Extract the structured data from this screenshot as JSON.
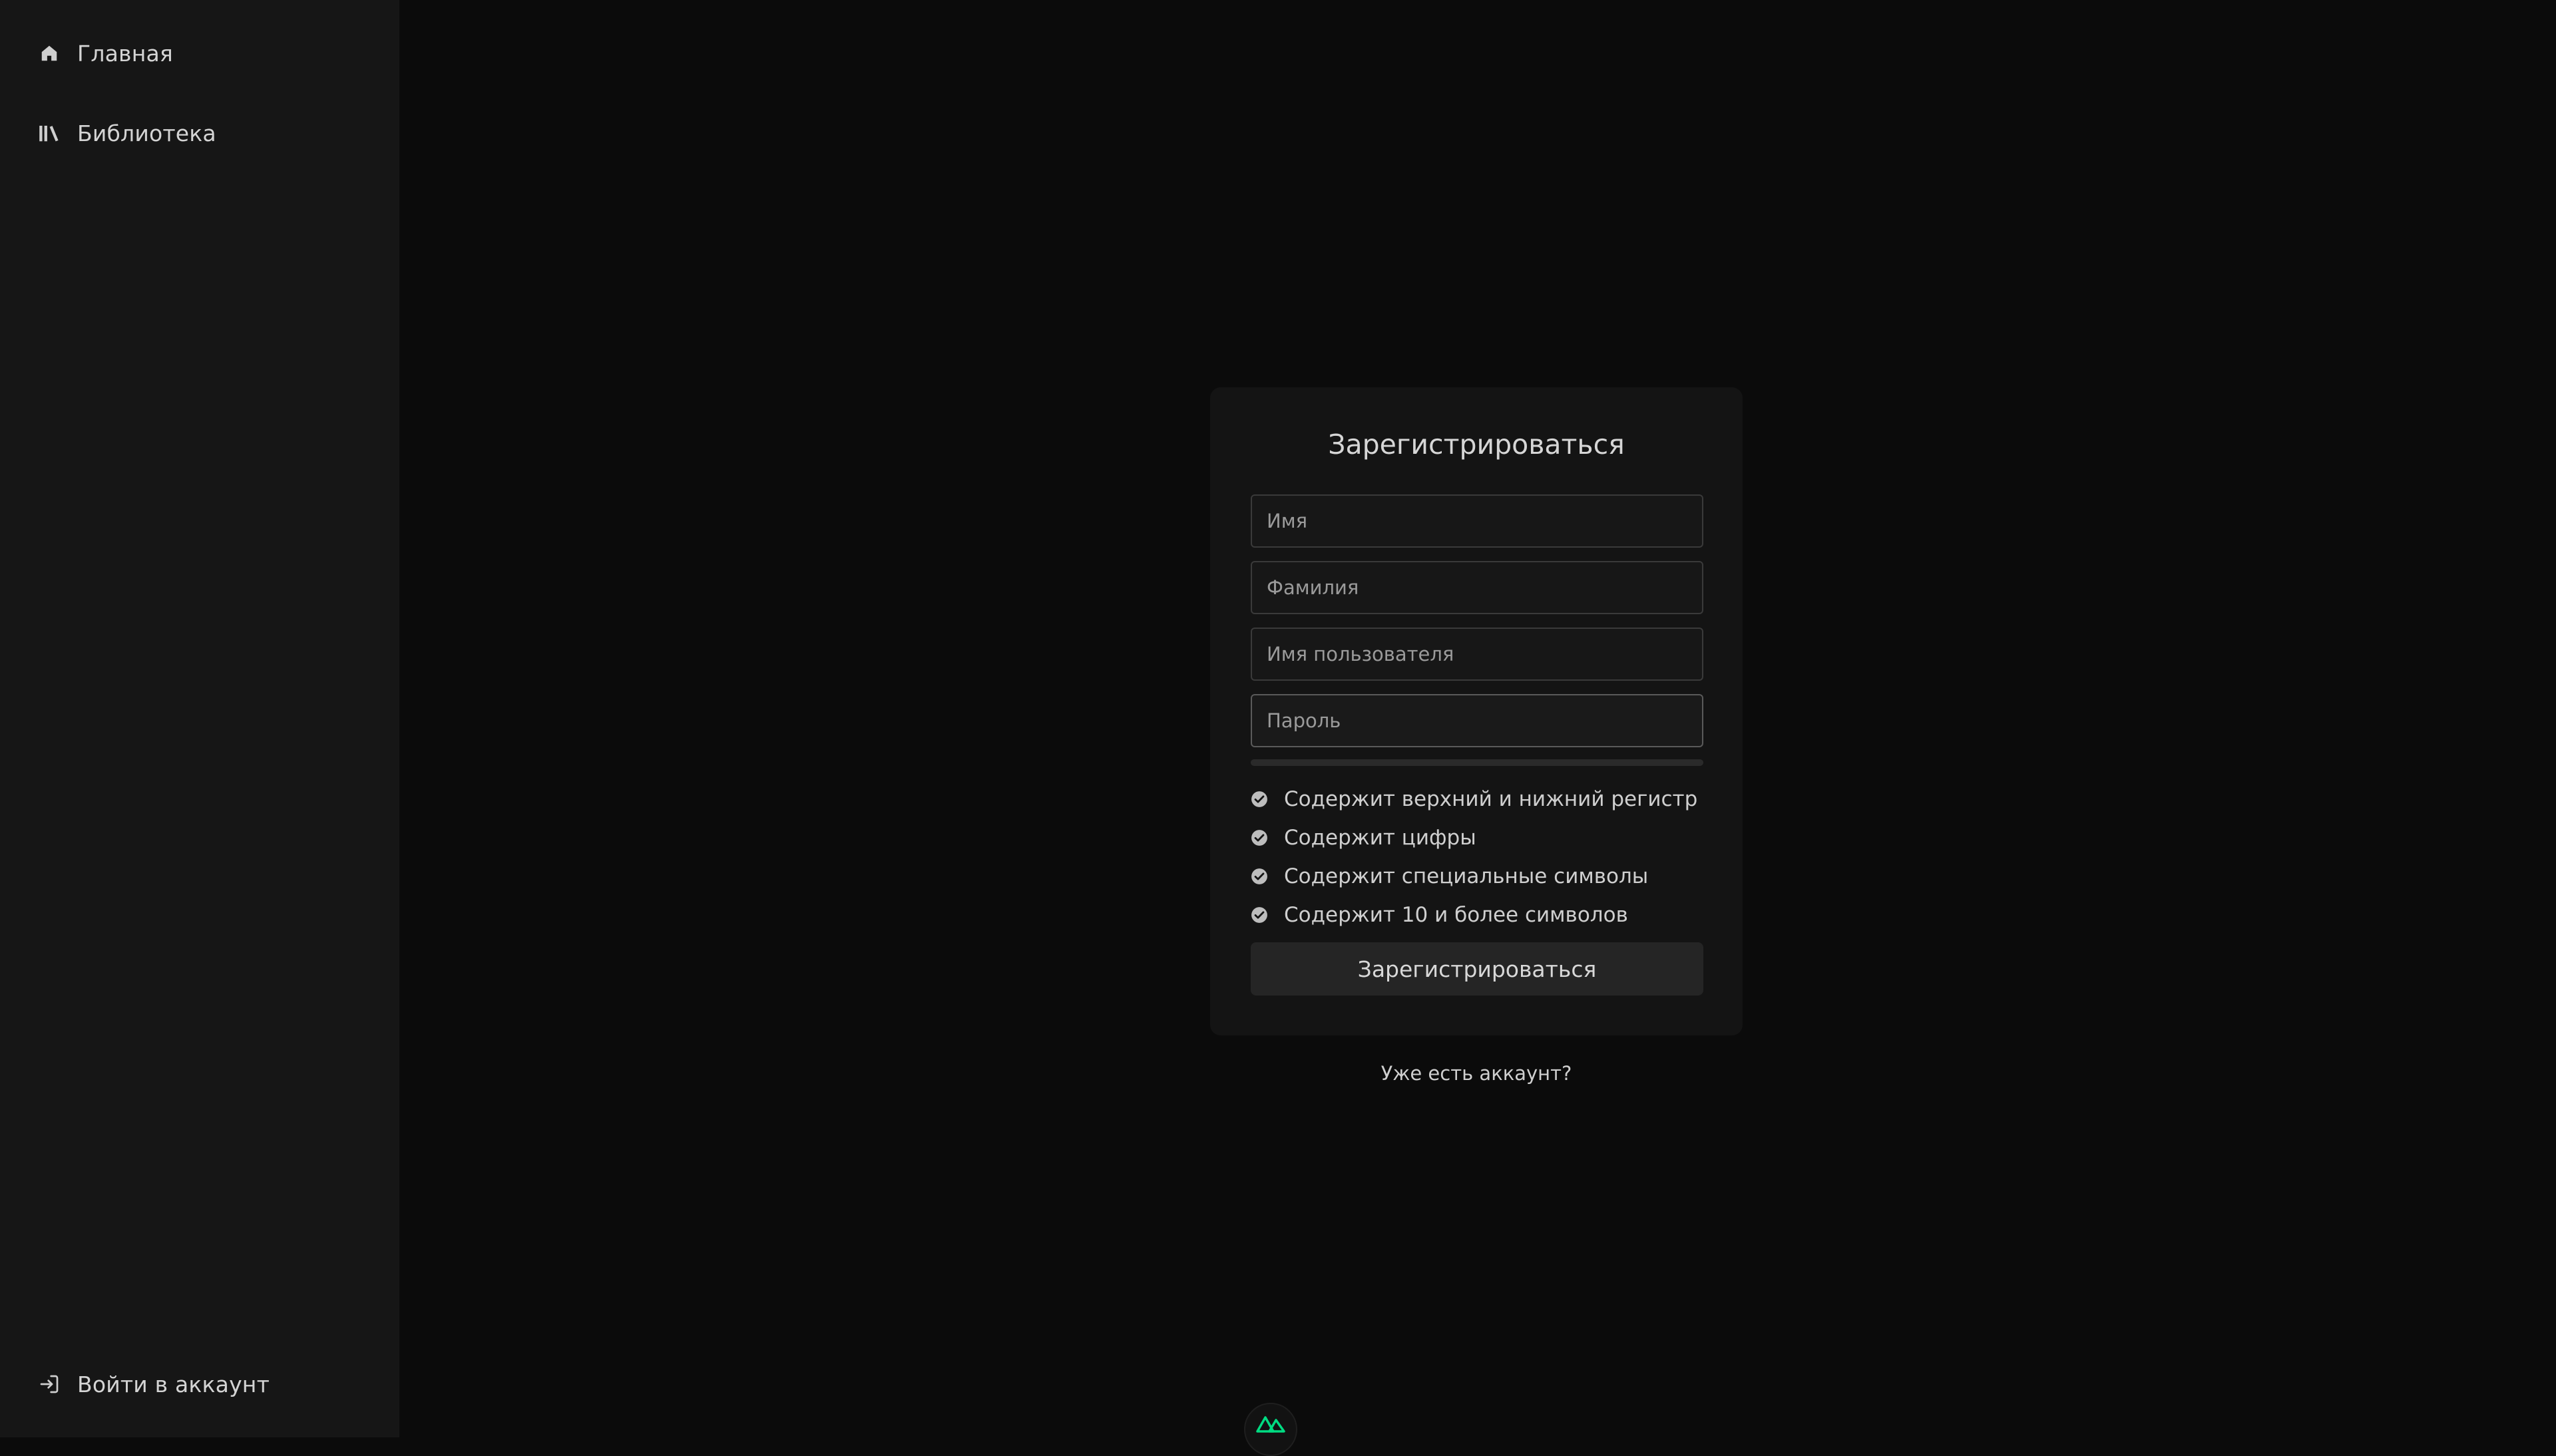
{
  "sidebar": {
    "items": [
      {
        "label": "Главная",
        "icon": "home-icon"
      },
      {
        "label": "Библиотека",
        "icon": "library-icon"
      }
    ],
    "footer": {
      "label": "Войти в аккаунт",
      "icon": "login-icon"
    }
  },
  "register": {
    "title": "Зарегистрироваться",
    "fields": {
      "first_name": {
        "placeholder": "Имя",
        "value": ""
      },
      "last_name": {
        "placeholder": "Фамилия",
        "value": ""
      },
      "username": {
        "placeholder": "Имя пользователя",
        "value": ""
      },
      "password": {
        "placeholder": "Пароль",
        "value": ""
      }
    },
    "password_rules": [
      {
        "text": "Содержит верхний и нижний регистр",
        "icon": "check-circle-icon"
      },
      {
        "text": "Содержит цифры",
        "icon": "check-circle-icon"
      },
      {
        "text": "Содержит специальные символы",
        "icon": "check-circle-icon"
      },
      {
        "text": "Содержит 10 и более символов",
        "icon": "check-circle-icon"
      }
    ],
    "submit_label": "Зарегистрироваться",
    "login_link": "Уже есть аккаунт?"
  },
  "colors": {
    "background": "#0b0b0b",
    "sidebar": "#161616",
    "card": "#141414",
    "accent_logo": "#00dc82"
  }
}
